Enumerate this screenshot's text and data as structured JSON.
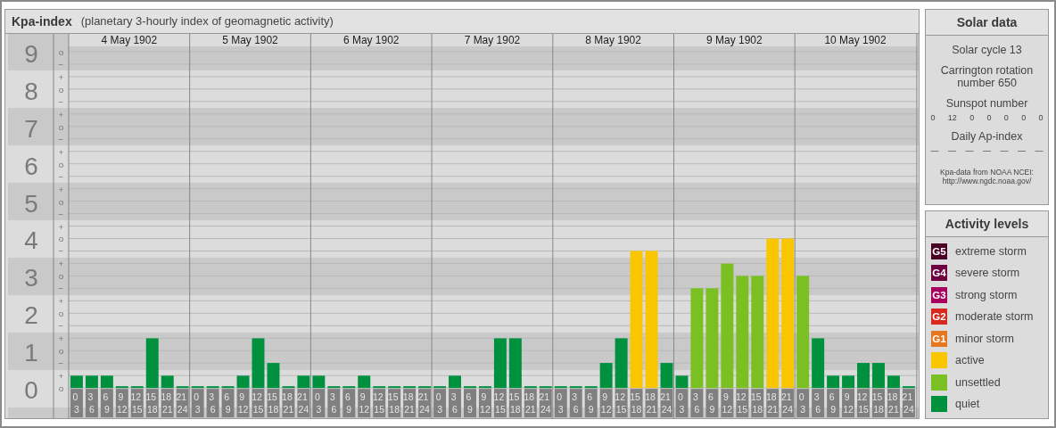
{
  "kp_panel": {
    "title": "Kpa-index",
    "subtitle": "(planetary 3-hourly index of geomagnetic activity)",
    "sublevels": [
      "o",
      "−",
      "+",
      "o",
      "−",
      "+",
      "o",
      "−",
      "+",
      "o",
      "−",
      "+",
      "o",
      "−",
      "+",
      "o",
      "−",
      "+",
      "o",
      "−",
      "+",
      "o",
      "−",
      "+",
      "o",
      "−",
      "+",
      "o"
    ],
    "days": [
      "4 May 1902",
      "5 May 1902",
      "6 May 1902",
      "7 May 1902",
      "8 May 1902",
      "9 May 1902",
      "10 May 1902"
    ],
    "chart_data": {
      "type": "bar",
      "grid": true,
      "ylim": [
        0,
        9
      ],
      "yticks": [
        {
          "value": 9,
          "label": "9"
        },
        {
          "value": 8,
          "label": "8"
        },
        {
          "value": 7,
          "label": "7"
        },
        {
          "value": 6,
          "label": "6"
        },
        {
          "value": 5,
          "label": "5"
        },
        {
          "value": 4,
          "label": "4"
        },
        {
          "value": 3,
          "label": "3"
        },
        {
          "value": 2,
          "label": "2"
        },
        {
          "value": 1,
          "label": "1"
        },
        {
          "value": 0,
          "label": "0"
        }
      ],
      "categories": [
        "0 3",
        "3 6",
        "6 9",
        "9 12",
        "12 15",
        "15 18",
        "18 21",
        "21 24",
        "0 3",
        "3 6",
        "6 9",
        "9 12",
        "12 15",
        "15 18",
        "18 21",
        "21 24",
        "0 3",
        "3 6",
        "6 9",
        "9 12",
        "12 15",
        "15 18",
        "18 21",
        "21 24",
        "0 3",
        "3 6",
        "6 9",
        "9 12",
        "12 15",
        "15 18",
        "18 21",
        "21 24",
        "0 3",
        "3 6",
        "6 9",
        "9 12",
        "12 15",
        "15 18",
        "18 21",
        "21 24",
        "0 3",
        "3 6",
        "6 9",
        "9 12",
        "12 15",
        "15 18",
        "18 21",
        "21 24",
        "0 3",
        "3 6",
        "6 9",
        "9 12",
        "12 15",
        "15 18",
        "18 21",
        "21 24"
      ],
      "series": [
        {
          "color": "#00913f",
          "values": [
            0.33,
            0.33,
            0.33,
            0,
            0,
            1.33,
            0.33,
            0,
            0,
            0,
            0,
            0.33,
            1.33,
            0.67,
            0,
            0.33,
            0.33,
            0,
            0,
            0.33,
            0,
            0,
            0,
            0,
            0,
            0.33,
            0,
            0,
            1.33,
            1.33,
            0,
            0,
            0,
            0,
            0,
            0.67,
            1.33,
            null,
            null,
            0.67,
            0.33,
            null,
            null,
            null,
            null,
            null,
            null,
            null,
            null,
            1.33,
            0.33,
            0.33,
            0.67,
            0.67,
            0.33,
            0
          ]
        },
        {
          "color": "#7bc023",
          "values": [
            null,
            null,
            null,
            null,
            null,
            null,
            null,
            null,
            null,
            null,
            null,
            null,
            null,
            null,
            null,
            null,
            null,
            null,
            null,
            null,
            null,
            null,
            null,
            null,
            null,
            null,
            null,
            null,
            null,
            null,
            null,
            null,
            null,
            null,
            null,
            null,
            null,
            null,
            null,
            null,
            null,
            2.67,
            2.67,
            3.33,
            3,
            3,
            null,
            null,
            3,
            null,
            null,
            null,
            null,
            null,
            null,
            null
          ]
        },
        {
          "color": "#f9c600",
          "values": [
            null,
            null,
            null,
            null,
            null,
            null,
            null,
            null,
            null,
            null,
            null,
            null,
            null,
            null,
            null,
            null,
            null,
            null,
            null,
            null,
            null,
            null,
            null,
            null,
            null,
            null,
            null,
            null,
            null,
            null,
            null,
            null,
            null,
            null,
            null,
            null,
            null,
            3.67,
            3.67,
            null,
            null,
            null,
            null,
            null,
            null,
            null,
            4,
            4,
            null,
            null,
            null,
            null,
            null,
            null,
            null,
            null
          ]
        }
      ]
    }
  },
  "solar_data": {
    "title": "Solar data",
    "solar_cycle": "Solar cycle 13",
    "carrington": "Carrington rotation number 650",
    "sunspot_heading": "Sunspot number",
    "sunspot_numbers": [
      "0",
      "12",
      "0",
      "0",
      "0",
      "0",
      "0"
    ],
    "ap_heading": "Daily Ap-index",
    "ap_values": [
      "—",
      "—",
      "—",
      "—",
      "—",
      "—",
      "—"
    ],
    "source": "Kpa-data from NOAA NCEI:",
    "source_url": "http://www.ngdc.noaa.gov/"
  },
  "activity_levels": {
    "title": "Activity levels",
    "items": [
      {
        "badge": "G5",
        "label": "extreme storm",
        "color": "#4a0026"
      },
      {
        "badge": "G4",
        "label": "severe storm",
        "color": "#6e0040"
      },
      {
        "badge": "G3",
        "label": "strong storm",
        "color": "#a8005e"
      },
      {
        "badge": "G2",
        "label": "moderate storm",
        "color": "#d9281e"
      },
      {
        "badge": "G1",
        "label": "minor storm",
        "color": "#e8761c"
      },
      {
        "label": "active",
        "color": "#f9c600"
      },
      {
        "label": "unsettled",
        "color": "#7bc023"
      },
      {
        "label": "quiet",
        "color": "#00913f"
      }
    ]
  }
}
